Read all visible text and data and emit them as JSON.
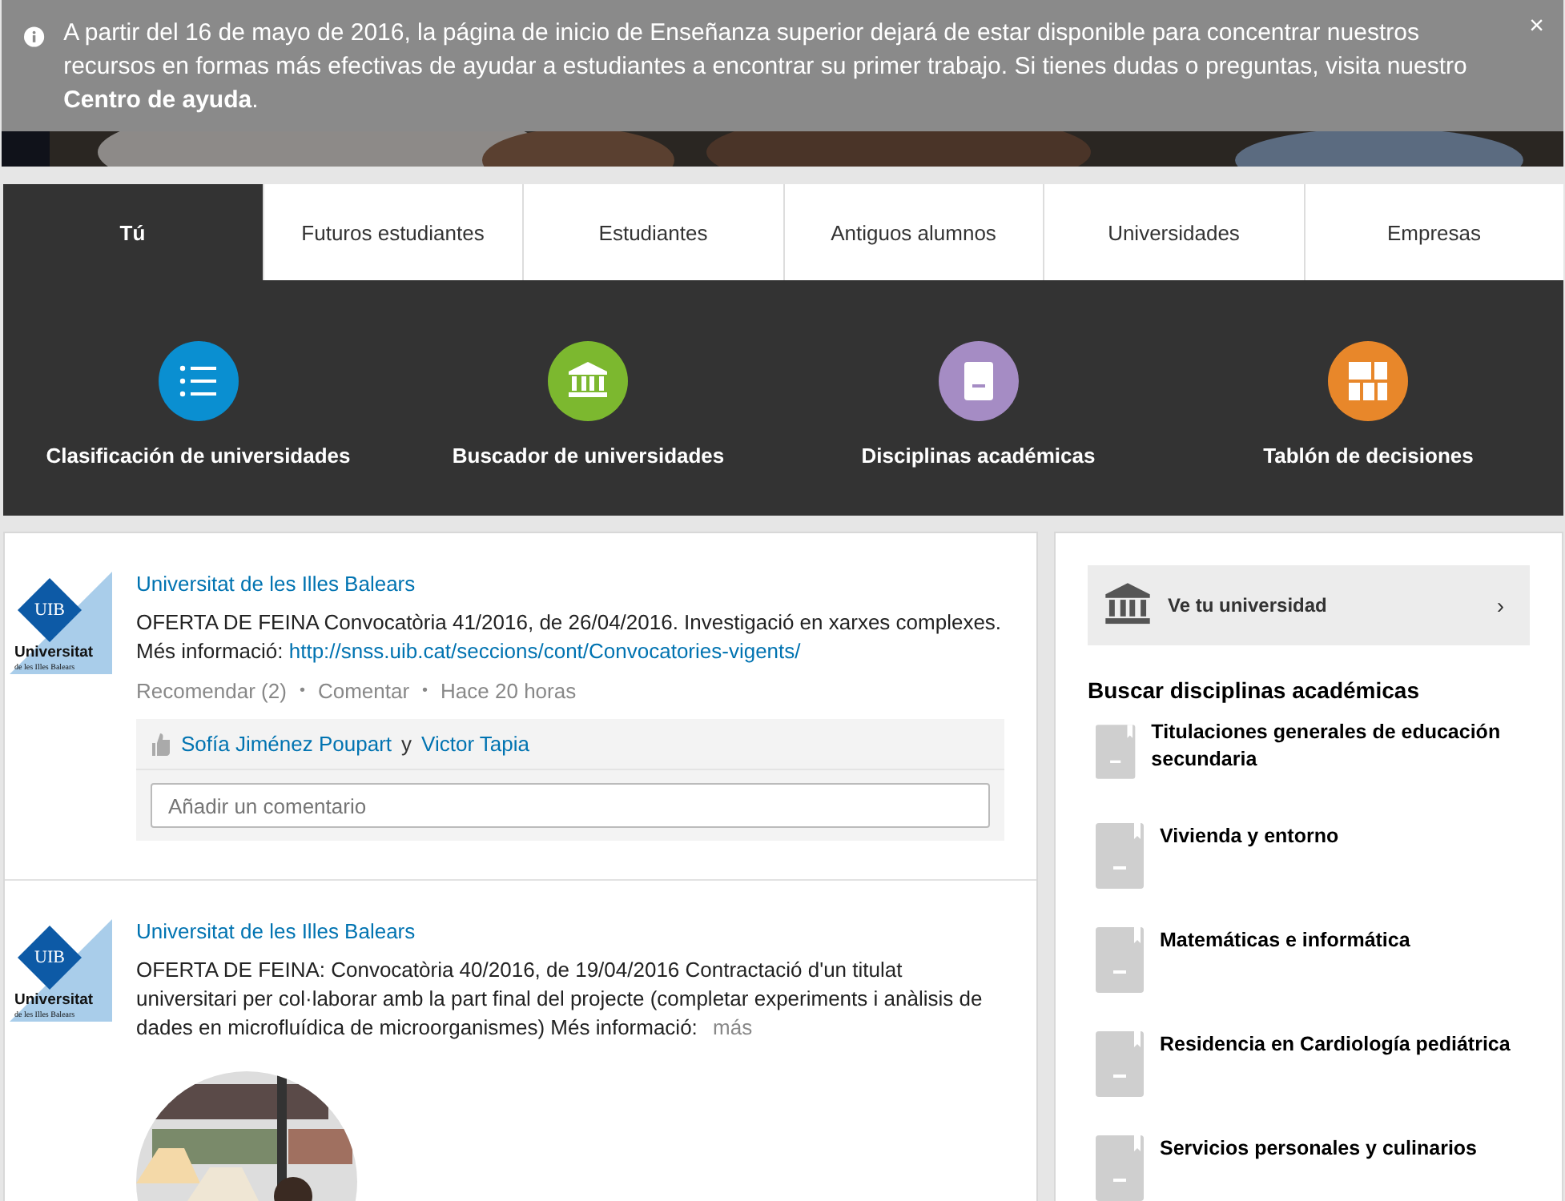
{
  "notice": {
    "text": "A partir del 16 de mayo de 2016, la página de inicio de Enseñanza superior dejará de estar disponible para concentrar nuestros recursos en formas más efectivas de ayudar a estudiantes a encontrar su primer trabajo. Si tienes dudas o preguntas, visita nuestro **Centro de ayuda**.",
    "close": "×"
  },
  "tabs": [
    {
      "label": "Tú",
      "selected": true
    },
    {
      "label": "Futuros estudiantes",
      "selected": false
    },
    {
      "label": "Estudiantes",
      "selected": false
    },
    {
      "label": "Antiguos alumnos",
      "selected": false
    },
    {
      "label": "Universidades",
      "selected": false
    },
    {
      "label": "Empresas",
      "selected": false
    }
  ],
  "shortcuts": [
    {
      "label": "Clasificación de universidades",
      "kind": "list",
      "color": "#0a8fd1"
    },
    {
      "label": "Buscador de universidades",
      "kind": "bank",
      "color": "#7cb82f"
    },
    {
      "label": "Disciplinas académicas",
      "kind": "book",
      "color": "#a58cc4"
    },
    {
      "label": "Tablón de decisiones",
      "kind": "grid",
      "color": "#e8872a"
    }
  ],
  "posts": [
    {
      "author": "Universitat de les Illes Balears",
      "logo": {
        "abbr": "UIB",
        "name": "Universitat",
        "subtitle": "de les Illes Balears"
      },
      "text": "OFERTA DE FEINA Convocatòria 41/2016, de 26/04/2016. Investigació en xarxes complexes. Més informació:",
      "link": "http://snss.uib.cat/seccions/cont/Convocatories-vigents/",
      "actions": [
        "Recomendar (2)",
        "Comentar",
        "Hace 20 horas"
      ],
      "separator": "•",
      "likers": [
        "Sofía Jiménez Poupart",
        "Victor Tapia"
      ],
      "joiner": "y",
      "comment_placeholder": "Añadir un comentario"
    },
    {
      "author": "Universitat de les Illes Balears",
      "logo": {
        "abbr": "UIB",
        "name": "Universitat",
        "subtitle": "de les Illes Balears"
      },
      "text": "OFERTA DE FEINA: Convocatòria 40/2016, de 19/04/2016 Contractació d'un titulat universitari per col·laborar amb la part final del projecte (completar experiments i anàlisis de dades en microfluídica de microorganismes) Més informació:",
      "more": "más"
    }
  ],
  "sidebar": {
    "cta": {
      "label": "Ve tu universidad",
      "chevron": "›"
    },
    "heading": "Buscar disciplinas académicas",
    "disciplines": [
      "Titulaciones generales de educación secundaria",
      "Vivienda y entorno",
      "Matemáticas e informática",
      "Residencia en Cardiología pediátrica",
      "Servicios personales y culinarios"
    ]
  }
}
